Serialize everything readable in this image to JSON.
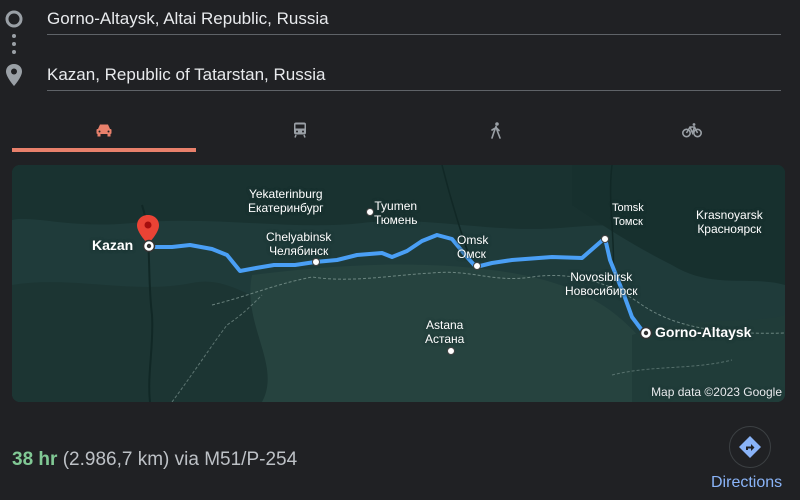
{
  "inputs": {
    "origin": "Gorno-Altaysk, Altai Republic, Russia",
    "destination": "Kazan, Republic of Tatarstan, Russia"
  },
  "tabs": [
    {
      "name": "driving",
      "icon": "car-icon",
      "active": true
    },
    {
      "name": "transit",
      "icon": "train-icon",
      "active": false
    },
    {
      "name": "walking",
      "icon": "walking-icon",
      "active": false
    },
    {
      "name": "cycling",
      "icon": "bicycle-icon",
      "active": false
    }
  ],
  "map": {
    "labels": {
      "yekaterinburg": {
        "en": "Yekaterinburg",
        "ru": "Екатеринбург"
      },
      "tyumen": {
        "en": "Tyumen",
        "ru": "Тюмень"
      },
      "chelyabinsk": {
        "en": "Chelyabinsk",
        "ru": "Челябинск"
      },
      "omsk": {
        "en": "Omsk",
        "ru": "Омск"
      },
      "tomsk": {
        "en": "Tomsk",
        "ru": "Томск"
      },
      "krasnoyarsk": {
        "en": "Krasnoyarsk",
        "ru": "Красноярск"
      },
      "novosibirsk": {
        "en": "Novosibirsk",
        "ru": "Новосибирск"
      },
      "astana": {
        "en": "Astana",
        "ru": "Астана"
      },
      "kazan": "Kazan",
      "gorno_altaysk": "Gorno-Altaysk"
    },
    "copyright": "Map data ©2023 Google"
  },
  "summary": {
    "duration": "38 hr",
    "distance": "(2.986,7 km)",
    "via": "via M51/P-254"
  },
  "directions_label": "Directions",
  "colors": {
    "background": "#202124",
    "accent_tab": "#e8806b",
    "duration_green": "#81c995",
    "link_blue": "#8ab4f8",
    "route_blue": "#4a9ff5",
    "map_land": "#1f3b3a",
    "pin_red": "#ea4335"
  }
}
